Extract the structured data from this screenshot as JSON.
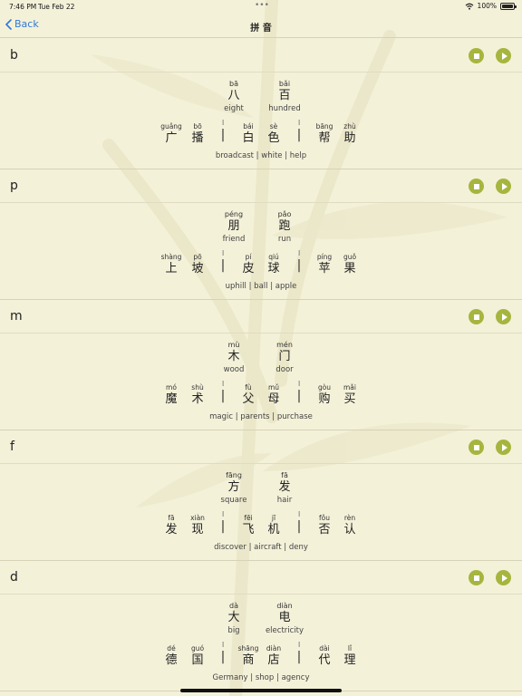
{
  "status": {
    "time": "7:46 PM",
    "date": "Tue Feb 22",
    "battery": "100%",
    "dots": "•••"
  },
  "nav": {
    "back_label": "Back",
    "title": "拼 音"
  },
  "sections": [
    {
      "letter": "b",
      "pair": [
        {
          "py": "bā",
          "hz": "八",
          "gloss": "eight"
        },
        {
          "py": "bǎi",
          "hz": "百",
          "gloss": "hundred"
        }
      ],
      "chars": [
        {
          "py": "guǎng",
          "hz": "广"
        },
        {
          "py": "bō",
          "hz": "播"
        },
        {
          "py": "bái",
          "hz": "白"
        },
        {
          "py": "sè",
          "hz": "色"
        },
        {
          "py": "bāng",
          "hz": "帮"
        },
        {
          "py": "zhù",
          "hz": "助"
        }
      ],
      "gloss": [
        "broadcast",
        "white",
        "help"
      ]
    },
    {
      "letter": "p",
      "pair": [
        {
          "py": "péng",
          "hz": "朋",
          "gloss": "friend"
        },
        {
          "py": "pǎo",
          "hz": "跑",
          "gloss": "run"
        }
      ],
      "chars": [
        {
          "py": "shàng",
          "hz": "上"
        },
        {
          "py": "pō",
          "hz": "坡"
        },
        {
          "py": "pí",
          "hz": "皮"
        },
        {
          "py": "qiú",
          "hz": "球"
        },
        {
          "py": "píng",
          "hz": "苹"
        },
        {
          "py": "guǒ",
          "hz": "果"
        }
      ],
      "gloss": [
        "uphill",
        "ball",
        "apple"
      ]
    },
    {
      "letter": "m",
      "pair": [
        {
          "py": "mù",
          "hz": "木",
          "gloss": "wood"
        },
        {
          "py": "mén",
          "hz": "门",
          "gloss": "door"
        }
      ],
      "chars": [
        {
          "py": "mó",
          "hz": "魔"
        },
        {
          "py": "shù",
          "hz": "术"
        },
        {
          "py": "fù",
          "hz": "父"
        },
        {
          "py": "mǔ",
          "hz": "母"
        },
        {
          "py": "gòu",
          "hz": "购"
        },
        {
          "py": "mǎi",
          "hz": "买"
        }
      ],
      "gloss": [
        "magic",
        "parents",
        "purchase"
      ]
    },
    {
      "letter": "f",
      "pair": [
        {
          "py": "fāng",
          "hz": "方",
          "gloss": "square"
        },
        {
          "py": "fā",
          "hz": "发",
          "gloss": "hair"
        }
      ],
      "chars": [
        {
          "py": "fā",
          "hz": "发"
        },
        {
          "py": "xiàn",
          "hz": "现"
        },
        {
          "py": "fēi",
          "hz": "飞"
        },
        {
          "py": "jī",
          "hz": "机"
        },
        {
          "py": "fǒu",
          "hz": "否"
        },
        {
          "py": "rèn",
          "hz": "认"
        }
      ],
      "gloss": [
        "discover",
        "aircraft",
        "deny"
      ]
    },
    {
      "letter": "d",
      "pair": [
        {
          "py": "dà",
          "hz": "大",
          "gloss": "big"
        },
        {
          "py": "diàn",
          "hz": "电",
          "gloss": "electricity"
        }
      ],
      "chars": [
        {
          "py": "dé",
          "hz": "德"
        },
        {
          "py": "guó",
          "hz": "国"
        },
        {
          "py": "shāng",
          "hz": "商"
        },
        {
          "py": "diàn",
          "hz": "店"
        },
        {
          "py": "dài",
          "hz": "代"
        },
        {
          "py": "lǐ",
          "hz": "理"
        }
      ],
      "gloss": [
        "Germany",
        "shop",
        "agency"
      ]
    }
  ],
  "colors": {
    "background": "#f4f1d9",
    "accent": "#a6b53e",
    "link": "#2f7ad8"
  },
  "icons": {
    "back": "chevron-left-icon",
    "stop": "stop-icon",
    "play": "play-icon",
    "wifi": "wifi-icon",
    "battery": "battery-icon"
  }
}
